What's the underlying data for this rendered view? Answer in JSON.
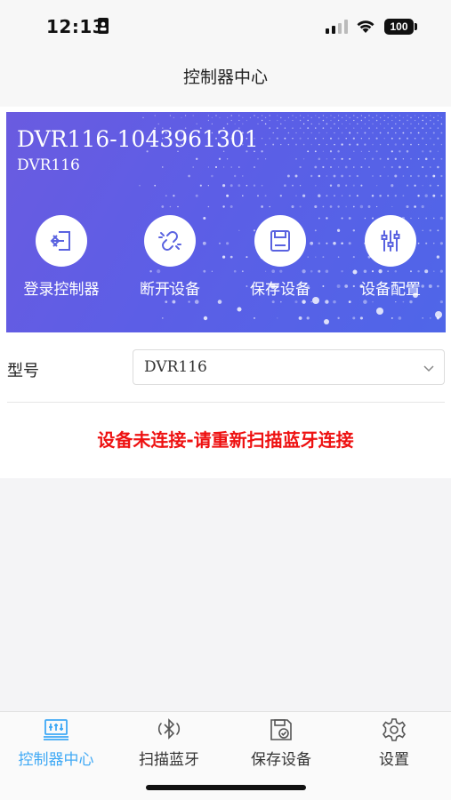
{
  "status_bar": {
    "time": "12:13",
    "battery": "100"
  },
  "nav": {
    "title": "控制器中心"
  },
  "device": {
    "name": "DVR116-1043961301",
    "model": "DVR116"
  },
  "actions": [
    {
      "label": "登录控制器",
      "icon": "login-icon"
    },
    {
      "label": "断开设备",
      "icon": "unlink-icon"
    },
    {
      "label": "保存设备",
      "icon": "save-icon"
    },
    {
      "label": "设备配置",
      "icon": "sliders-icon"
    }
  ],
  "form": {
    "model_label": "型号",
    "model_value": "DVR116"
  },
  "status_message": "设备未连接-请重新扫描蓝牙连接",
  "tabs": [
    {
      "label": "控制器中心",
      "icon": "controller-icon",
      "active": true
    },
    {
      "label": "扫描蓝牙",
      "icon": "bluetooth-icon",
      "active": false
    },
    {
      "label": "保存设备",
      "icon": "save-check-icon",
      "active": false
    },
    {
      "label": "设置",
      "icon": "gear-icon",
      "active": false
    }
  ],
  "colors": {
    "accent": "#3fa9f5",
    "banner": "#5c5ee6",
    "error": "#ee1111"
  }
}
